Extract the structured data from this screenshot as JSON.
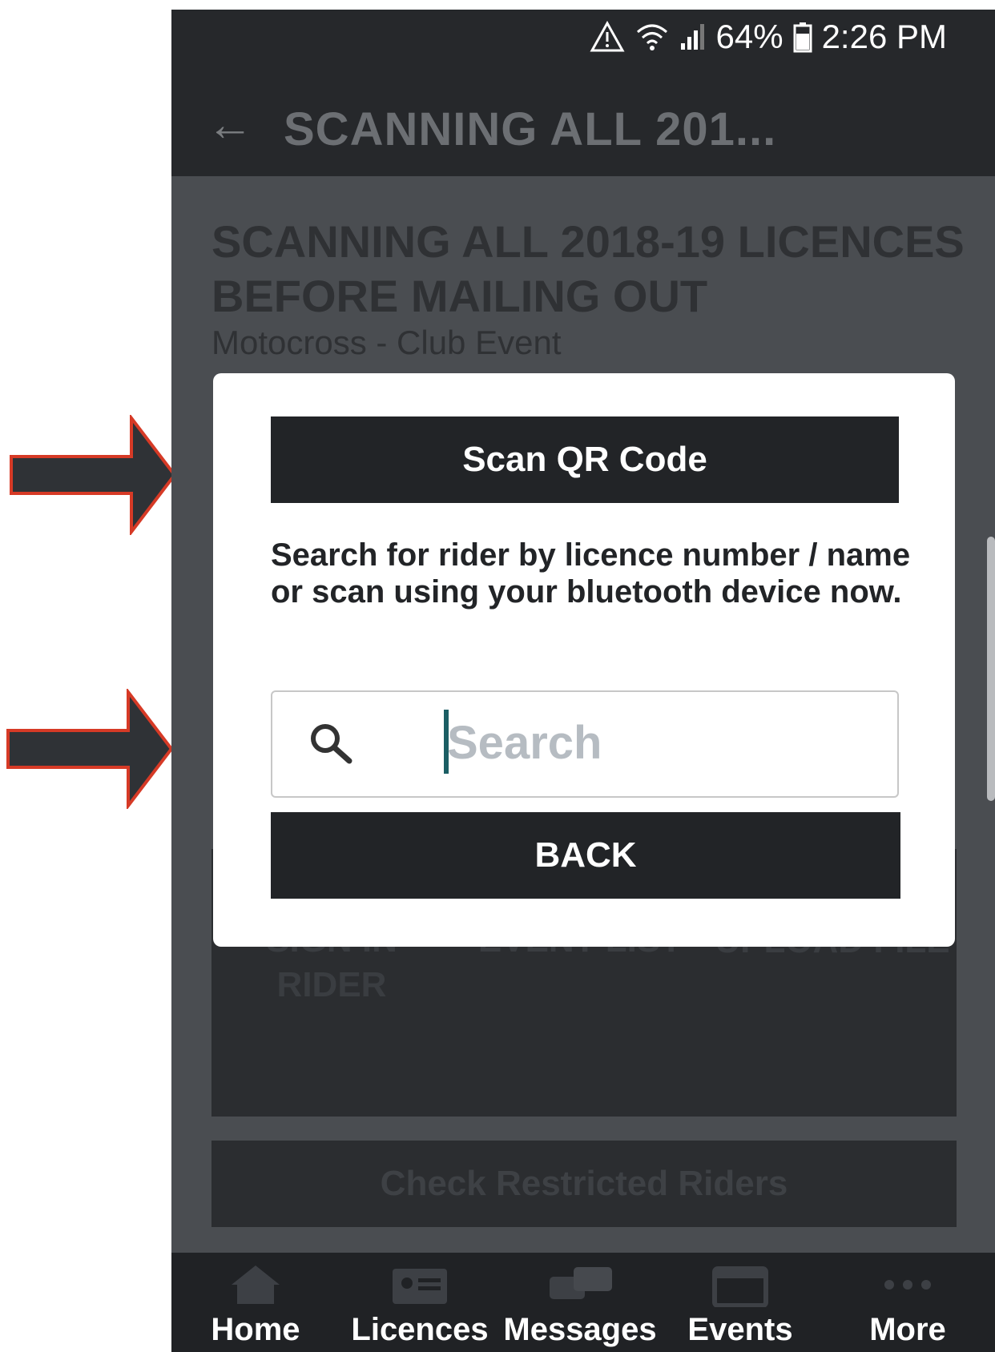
{
  "status_bar": {
    "battery": "64%",
    "time": "2:26 PM"
  },
  "app_bar": {
    "title": "SCANNING ALL 201..."
  },
  "event": {
    "title": "SCANNING ALL 2018-19 LICENCES BEFORE MAILING OUT",
    "subtitle": "Motocross - Club Event"
  },
  "tiles": [
    {
      "label": "SIGN IN RIDER",
      "icon": "add-user-icon"
    },
    {
      "label": "EVENT LIST",
      "icon": "document-icon"
    },
    {
      "label": "UPLOAD FILE",
      "icon": "upload-icon"
    }
  ],
  "restricted_button": "Check Restricted Riders",
  "dialog": {
    "scan_label": "Scan QR Code",
    "instruction": "Search for rider by licence number / name or scan using your bluetooth device now.",
    "search_placeholder": "Search",
    "back_label": "BACK"
  },
  "bottom_nav": [
    {
      "label": "Home",
      "icon": "home-icon"
    },
    {
      "label": "Licences",
      "icon": "licence-card-icon"
    },
    {
      "label": "Messages",
      "icon": "chat-icon"
    },
    {
      "label": "Events",
      "icon": "calendar-icon"
    },
    {
      "label": "More",
      "icon": "more-dots-icon"
    }
  ],
  "colors": {
    "annotation_arrow_fill": "#2f3236",
    "annotation_arrow_stroke": "#d63a26",
    "caret": "#1b5e64"
  }
}
